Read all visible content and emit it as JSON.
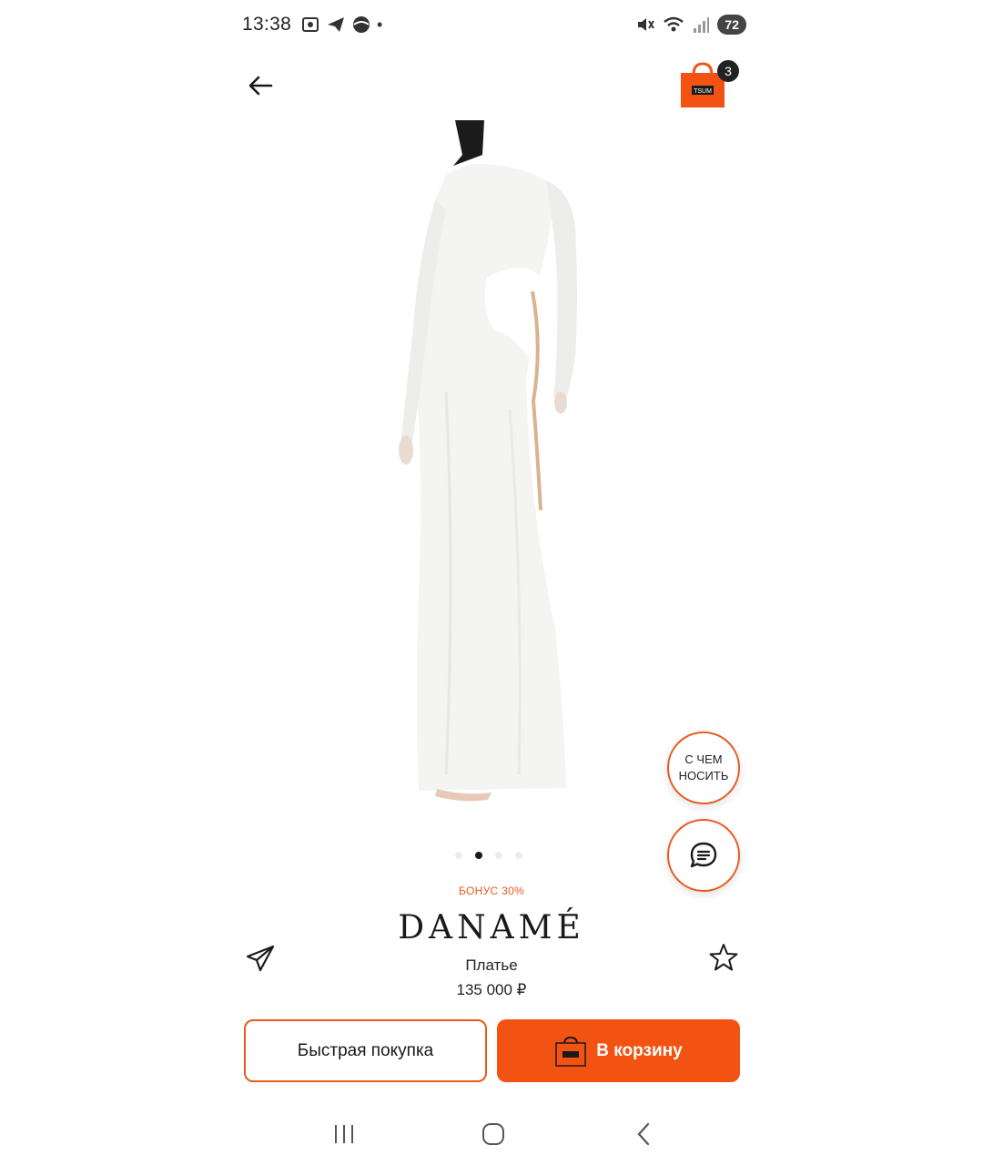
{
  "status_bar": {
    "time": "13:38",
    "battery": "72"
  },
  "header": {
    "cart_count": "3",
    "cart_logo_text": "TSUM"
  },
  "gallery": {
    "total_images": 4,
    "active_index": 1
  },
  "fabs": {
    "outfit_line1": "С ЧЕМ",
    "outfit_line2": "НОСИТЬ"
  },
  "product": {
    "bonus": "БОНУС 30%",
    "brand": "DANAMÉ",
    "name": "Платье",
    "price": "135 000 ₽"
  },
  "actions": {
    "quick_buy_label": "Быстрая покупка",
    "add_to_cart_label": "В корзину"
  },
  "colors": {
    "accent": "#f25313",
    "accent_border": "#e85a1e"
  },
  "icons": {
    "back": "arrow-left-icon",
    "cart": "shopping-bag-icon",
    "chat": "chat-bubble-icon",
    "share": "paper-plane-icon",
    "favorite": "star-icon"
  }
}
